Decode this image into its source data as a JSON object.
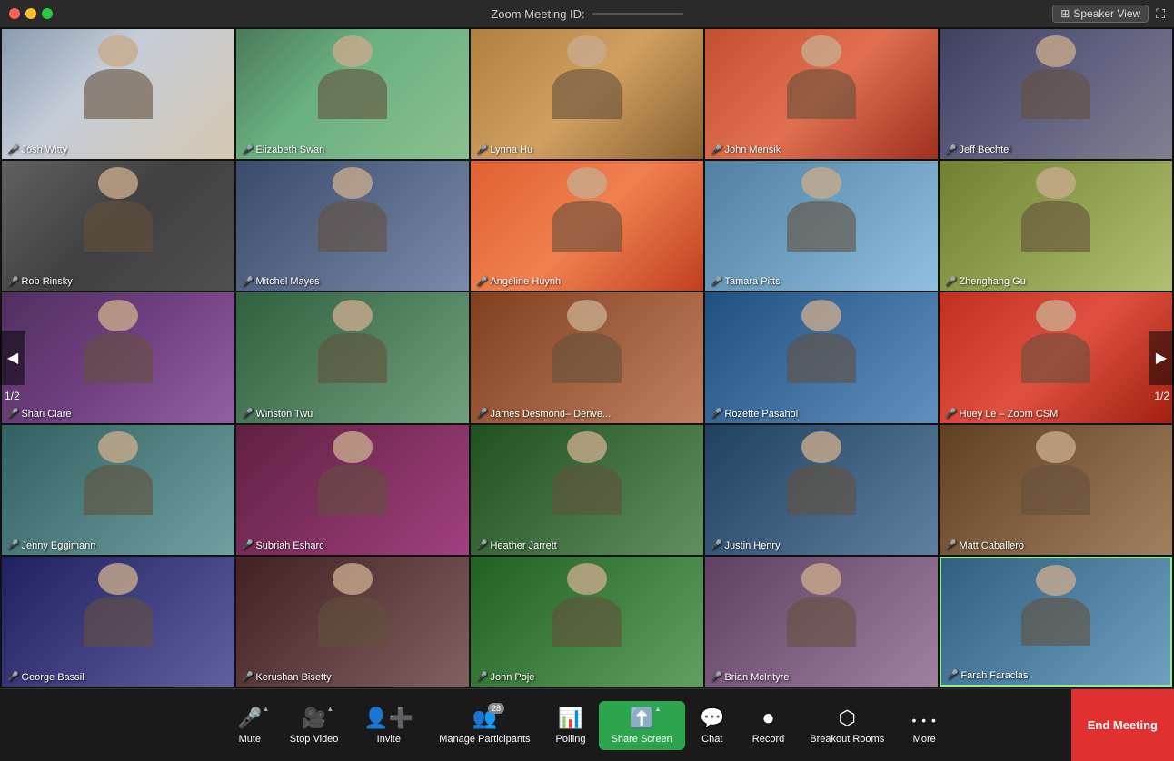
{
  "titleBar": {
    "text": "Zoom Meeting ID:",
    "meetingId": "           ",
    "speakerView": "Speaker View",
    "buttons": [
      "close",
      "minimize",
      "maximize"
    ]
  },
  "participants": [
    {
      "name": "Josh Witty",
      "micMuted": true,
      "bg": 0
    },
    {
      "name": "Elizabeth Swan",
      "micMuted": true,
      "bg": 1
    },
    {
      "name": "Lynna Hu",
      "micMuted": true,
      "bg": 2
    },
    {
      "name": "John Mensik",
      "micMuted": true,
      "bg": 3
    },
    {
      "name": "Jeff Bechtel",
      "micMuted": true,
      "bg": 4
    },
    {
      "name": "Rob Rinsky",
      "micMuted": true,
      "bg": 5
    },
    {
      "name": "Mitchel Mayes",
      "micMuted": true,
      "bg": 6
    },
    {
      "name": "Angeline Huynh",
      "micMuted": true,
      "bg": 7
    },
    {
      "name": "Tamara Pitts",
      "micMuted": true,
      "bg": 8
    },
    {
      "name": "Zhenghang Gu",
      "micMuted": true,
      "bg": 9
    },
    {
      "name": "Shari Clare",
      "micMuted": true,
      "bg": 10
    },
    {
      "name": "Winston Twu",
      "micMuted": true,
      "bg": 11
    },
    {
      "name": "James Desmond– Denve...",
      "micMuted": true,
      "bg": 12
    },
    {
      "name": "Rozette Pasahol",
      "micMuted": true,
      "bg": 13
    },
    {
      "name": "Huey Le – Zoom CSM",
      "micMuted": true,
      "bg": 14
    },
    {
      "name": "Jenny Eggimann",
      "micMuted": true,
      "bg": 15
    },
    {
      "name": "Subriah Esharc",
      "micMuted": true,
      "bg": 16
    },
    {
      "name": "Heather Jarrett",
      "micMuted": true,
      "bg": 17
    },
    {
      "name": "Justin Henry",
      "micMuted": true,
      "bg": 18
    },
    {
      "name": "Matt Caballero",
      "micMuted": true,
      "bg": 19
    },
    {
      "name": "George Bassil",
      "micMuted": true,
      "bg": 20
    },
    {
      "name": "Kerushan Bisetty",
      "micMuted": true,
      "bg": 21
    },
    {
      "name": "John Poje",
      "micMuted": true,
      "bg": 22
    },
    {
      "name": "Brian McIntyre",
      "micMuted": true,
      "bg": 23
    },
    {
      "name": "Farah Faraclas",
      "micMuted": false,
      "bg": 24,
      "highlighted": true
    }
  ],
  "nav": {
    "leftPage": "1/2",
    "rightPage": "1/2",
    "leftArrow": "◀",
    "rightArrow": "▶"
  },
  "toolbar": {
    "mute": "Mute",
    "stopVideo": "Stop Video",
    "invite": "Invite",
    "manageParticipants": "Manage Participants",
    "participantCount": "28",
    "polling": "Polling",
    "shareScreen": "Share Screen",
    "chat": "Chat",
    "record": "Record",
    "breakoutRooms": "Breakout Rooms",
    "more": "More",
    "endMeeting": "End Meeting"
  }
}
